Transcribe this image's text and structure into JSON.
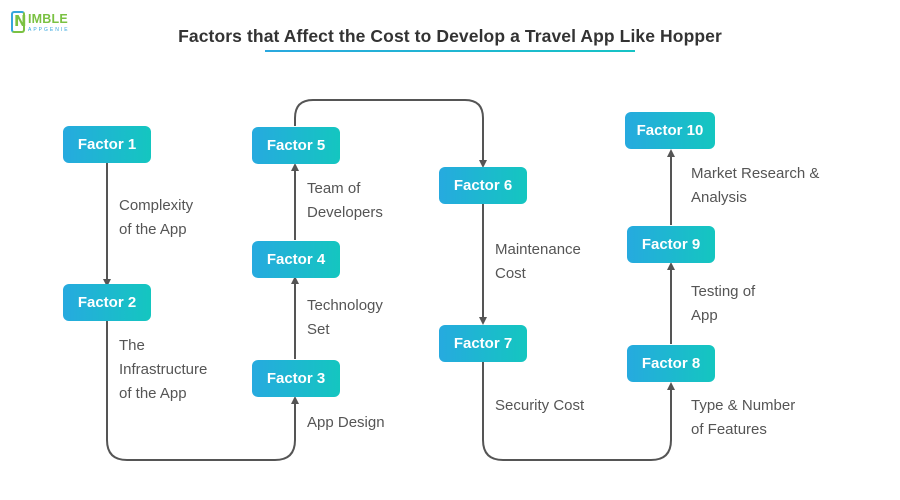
{
  "brand": {
    "logo_text": "IMBLE",
    "logo_initial": "N",
    "logo_subtext": "APPGENIE",
    "colors": {
      "green": "#7ac142",
      "blue": "#35a6dd"
    }
  },
  "title": "Factors that Affect the Cost to Develop a Travel App Like Hopper",
  "colors": {
    "box_gradient_start": "#26aadf",
    "box_gradient_end": "#14c6c0",
    "connector": "#555555",
    "label_text": "#555555",
    "title_text": "#333333"
  },
  "factors": [
    {
      "label": "Factor 1",
      "description_lines": [
        "Complexity",
        "of the App"
      ]
    },
    {
      "label": "Factor 2",
      "description_lines": [
        "The",
        "Infrastructure",
        "of the App"
      ]
    },
    {
      "label": "Factor 3",
      "description_lines": [
        "App Design"
      ]
    },
    {
      "label": "Factor 4",
      "description_lines": [
        "Technology",
        "Set"
      ]
    },
    {
      "label": "Factor 5",
      "description_lines": [
        "Team of",
        "Developers"
      ]
    },
    {
      "label": "Factor 6",
      "description_lines": [
        "Maintenance",
        "Cost"
      ]
    },
    {
      "label": "Factor 7",
      "description_lines": [
        "Security Cost"
      ]
    },
    {
      "label": "Factor 8",
      "description_lines": [
        "Type & Number",
        "of Features"
      ]
    },
    {
      "label": "Factor 9",
      "description_lines": [
        "Testing of",
        "App"
      ]
    },
    {
      "label": "Factor 10",
      "description_lines": [
        "Market Research &",
        "Analysis"
      ]
    }
  ],
  "flow_order": [
    "Factor 1",
    "Factor 2",
    "Factor 3",
    "Factor 4",
    "Factor 5",
    "Factor 6",
    "Factor 7",
    "Factor 8",
    "Factor 9",
    "Factor 10"
  ]
}
